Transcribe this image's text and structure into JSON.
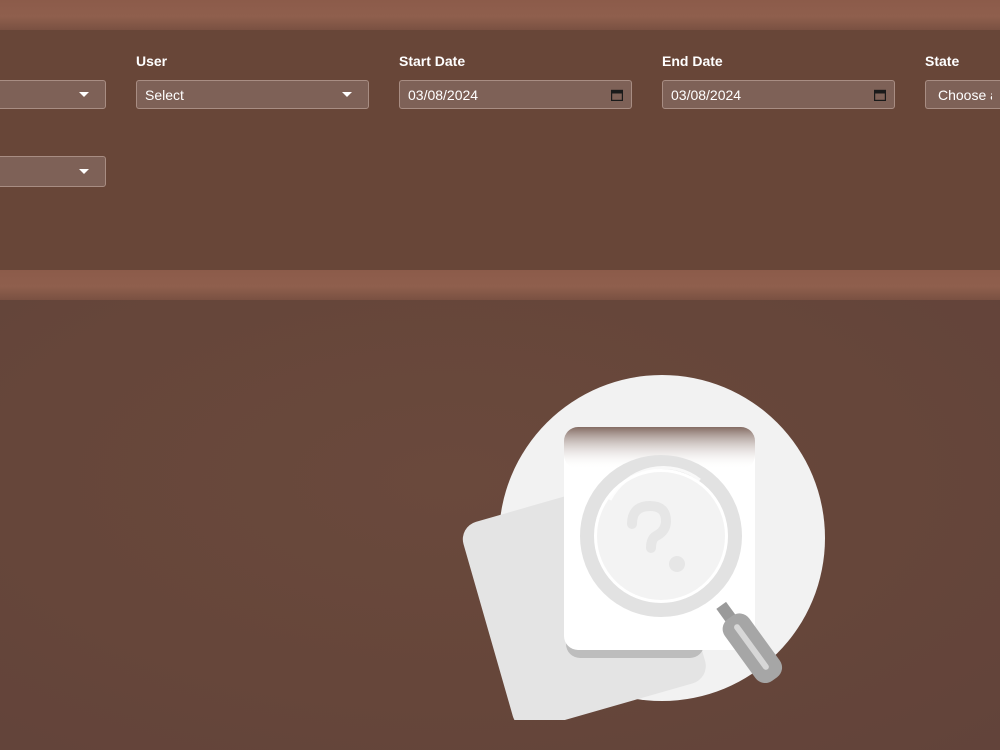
{
  "filters": {
    "first_dropdown": {
      "value": ""
    },
    "user": {
      "label": "User",
      "value": "Select"
    },
    "start_date": {
      "label": "Start Date",
      "value": "03/08/2024"
    },
    "end_date": {
      "label": "End Date",
      "value": "03/08/2024"
    },
    "state": {
      "label": "State",
      "value": "Choose a"
    },
    "second_row_dropdown": {
      "value": ""
    }
  },
  "icons": {
    "dropdown": "chevron-down-icon",
    "date": "calendar-icon",
    "empty_state": "search-document-icon"
  },
  "colors": {
    "background": "#66463a",
    "band": "#8c5b4a",
    "input_background": "#7e6157",
    "input_border": "#a88d83"
  }
}
